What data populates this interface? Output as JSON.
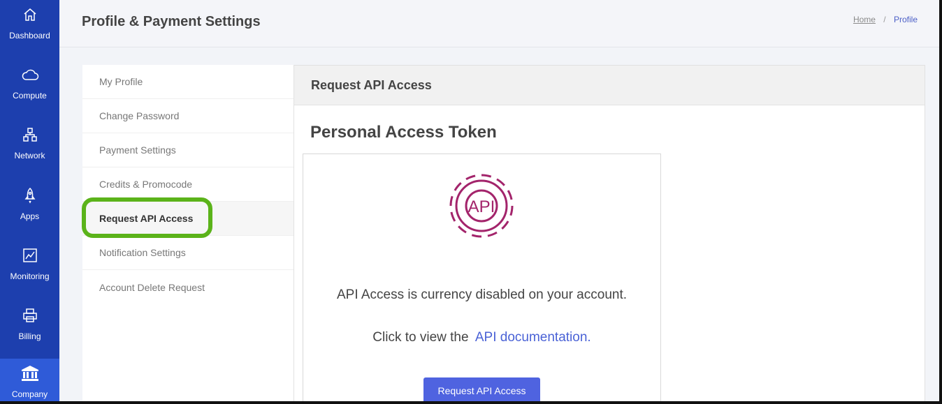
{
  "nav": {
    "items": [
      {
        "label": "Dashboard",
        "icon": "home-icon"
      },
      {
        "label": "Compute",
        "icon": "cloud-icon"
      },
      {
        "label": "Network",
        "icon": "network-icon"
      },
      {
        "label": "Apps",
        "icon": "rocket-icon"
      },
      {
        "label": "Monitoring",
        "icon": "chart-icon"
      },
      {
        "label": "Billing",
        "icon": "printer-icon"
      },
      {
        "label": "Company",
        "icon": "bank-icon"
      }
    ],
    "active": "Company"
  },
  "header": {
    "title": "Profile & Payment Settings",
    "breadcrumb": {
      "home": "Home",
      "separator": "/",
      "current": "Profile"
    }
  },
  "menu": {
    "items": [
      {
        "label": "My Profile"
      },
      {
        "label": "Change Password"
      },
      {
        "label": "Payment Settings"
      },
      {
        "label": "Credits & Promocode"
      },
      {
        "label": "Request API Access"
      },
      {
        "label": "Notification Settings"
      },
      {
        "label": "Account Delete Request"
      }
    ],
    "active": "Request API Access"
  },
  "panel": {
    "heading": "Request API Access",
    "section_title": "Personal Access Token",
    "logo_text": "API",
    "message": "API Access is currency disabled on your account.",
    "doc_prefix": "Click to view the",
    "doc_link": "API documentation.",
    "button_label": "Request API Access"
  },
  "colors": {
    "rail": "#1d3fae",
    "rail_active": "#2f5bd8",
    "accent": "#4f63e0",
    "highlight": "#5bb31a",
    "logo": "#a3246b"
  }
}
